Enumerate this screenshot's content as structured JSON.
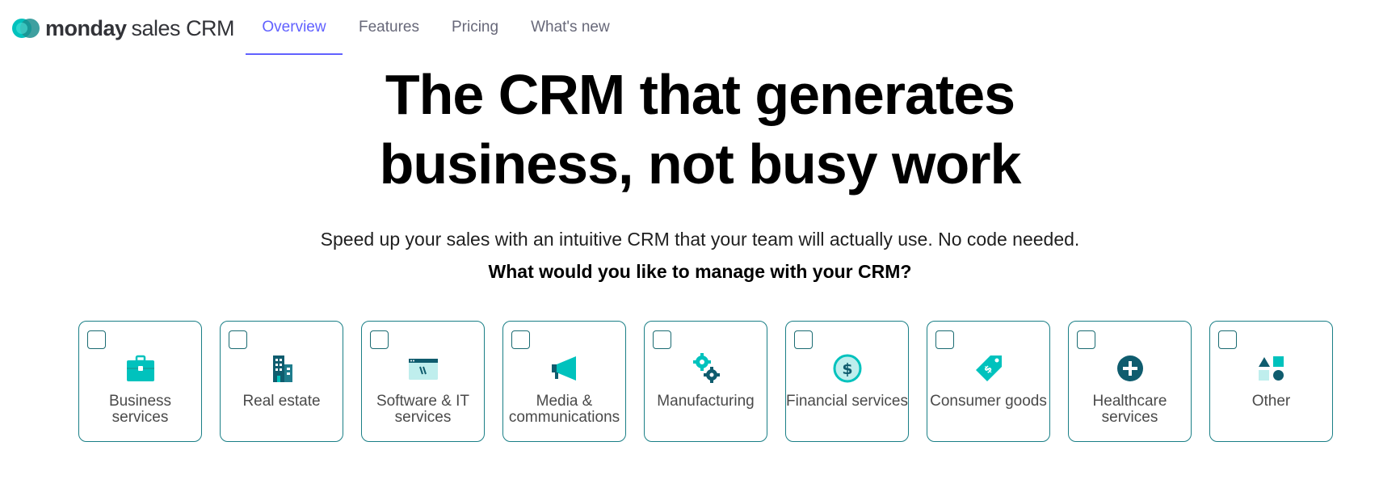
{
  "header": {
    "logo": {
      "brand": "monday",
      "product": "sales CRM"
    },
    "nav": [
      {
        "label": "Overview",
        "active": true
      },
      {
        "label": "Features",
        "active": false
      },
      {
        "label": "Pricing",
        "active": false
      },
      {
        "label": "What's new",
        "active": false
      }
    ]
  },
  "hero": {
    "headline_line1": "The CRM that generates",
    "headline_line2": "business, not busy work",
    "subtitle": "Speed up your sales with an intuitive CRM that your team will actually use. No code needed.",
    "question": "What would you like to manage with your CRM?"
  },
  "cards": [
    {
      "label": "Business services",
      "icon": "briefcase-icon",
      "checked": false
    },
    {
      "label": "Real estate",
      "icon": "buildings-icon",
      "checked": false
    },
    {
      "label": "Software & IT services",
      "icon": "browser-window-icon",
      "checked": false
    },
    {
      "label": "Media & communications",
      "icon": "megaphone-icon",
      "checked": false
    },
    {
      "label": "Manufacturing",
      "icon": "gears-icon",
      "checked": false
    },
    {
      "label": "Financial services",
      "icon": "dollar-coin-icon",
      "checked": false
    },
    {
      "label": "Consumer goods",
      "icon": "price-tag-icon",
      "checked": false
    },
    {
      "label": "Healthcare services",
      "icon": "medical-plus-icon",
      "checked": false
    },
    {
      "label": "Other",
      "icon": "shapes-icon",
      "checked": false
    }
  ],
  "colors": {
    "accent": "#6161ff",
    "card_border": "#1a7f86",
    "icon_teal": "#00c2bd",
    "icon_dark": "#0f5c6e"
  }
}
